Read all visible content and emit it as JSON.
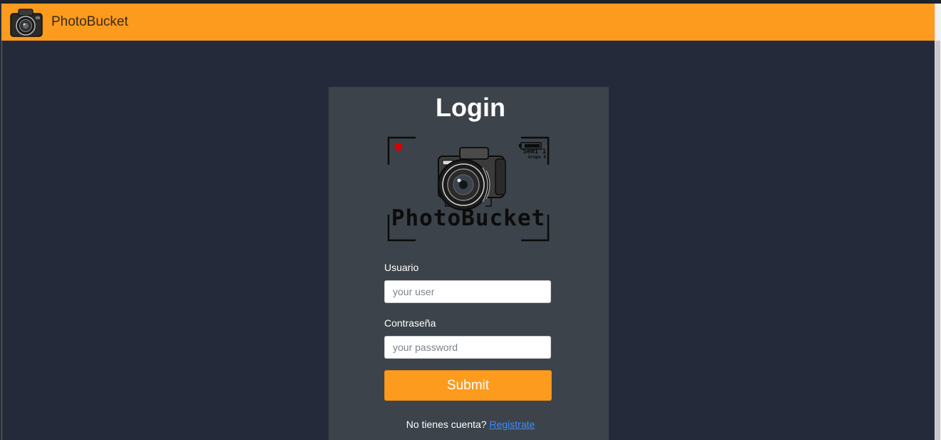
{
  "navbar": {
    "brand": "PhotoBucket",
    "logo_icon": "camera-icon",
    "background": "#fd9b1e"
  },
  "login": {
    "title": "Login",
    "logo": {
      "icon": "camera-icon",
      "wordmark": "PhotoBucket",
      "tag_line1": "Semi 1",
      "tag_line2": "Grupo 8"
    },
    "username": {
      "label": "Usuario",
      "placeholder": "your user",
      "value": ""
    },
    "password": {
      "label": "Contraseña",
      "placeholder": "your password",
      "value": ""
    },
    "submit_label": "Submit",
    "signup_prompt": "No tienes cuenta?",
    "signup_link": "Registrate"
  },
  "colors": {
    "page_background": "#252a3a",
    "card_background": "#3c434a",
    "accent": "#fd9b1e",
    "link": "#3f8cff"
  }
}
